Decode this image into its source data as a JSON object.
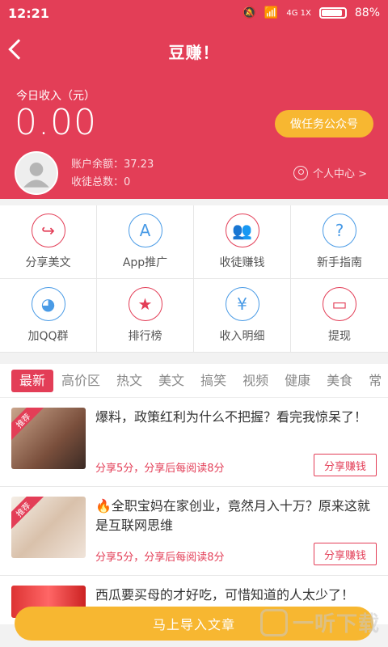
{
  "status": {
    "time": "12:21",
    "battery": "88%",
    "net": "4G 1X"
  },
  "header": {
    "title": "豆赚！"
  },
  "today": {
    "label": "今日收入（元）",
    "value": "0.00",
    "task_button": "做任务公众号"
  },
  "account": {
    "balance": "账户余额：37.23",
    "followers": "收徒总数：0",
    "center": "个人中心 >"
  },
  "grid": [
    {
      "label": "分享美文",
      "icon": "share-icon"
    },
    {
      "label": "App推广",
      "icon": "appstore-icon"
    },
    {
      "label": "收徒赚钱",
      "icon": "people-icon"
    },
    {
      "label": "新手指南",
      "icon": "help-icon"
    },
    {
      "label": "加QQ群",
      "icon": "qq-icon"
    },
    {
      "label": "排行榜",
      "icon": "medal-icon"
    },
    {
      "label": "收入明细",
      "icon": "receipt-icon"
    },
    {
      "label": "提现",
      "icon": "wallet-icon"
    }
  ],
  "tabs": [
    "最新",
    "高价区",
    "热文",
    "美文",
    "搞笑",
    "视频",
    "健康",
    "美食",
    "常"
  ],
  "feed": [
    {
      "badge": "推荐",
      "title": "爆料，政策红利为什么不把握？看完我惊呆了！",
      "meta": "分享5分，分享后每阅读8分",
      "action": "分享赚钱"
    },
    {
      "badge": "推荐",
      "title": "🔥全职宝妈在家创业，竟然月入十万？原来这就是互联网思维",
      "meta": "分享5分，分享后每阅读8分",
      "action": "分享赚钱"
    },
    {
      "title": "西瓜要买母的才好吃，可惜知道的人太少了！"
    }
  ],
  "import_button": "马上导入文章",
  "watermark": "一听下载",
  "colors": {
    "primary": "#e33e57",
    "accent": "#f7b731",
    "blue": "#4a9be6"
  }
}
